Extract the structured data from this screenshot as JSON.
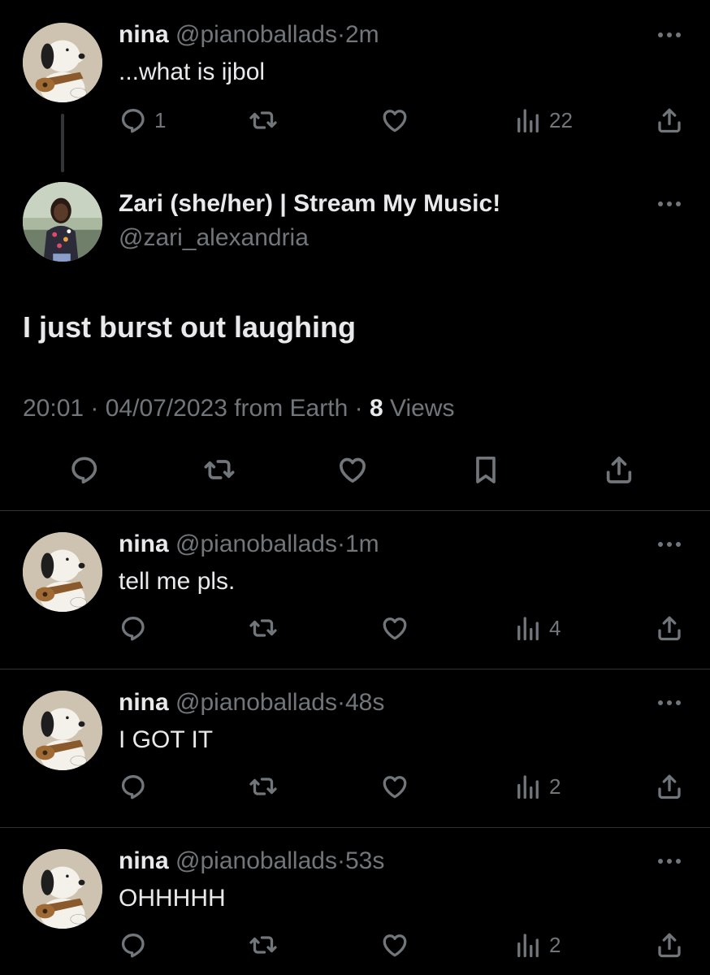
{
  "tweets": [
    {
      "name": "nina",
      "handle": "@pianoballads",
      "time": "2m",
      "text": "...what is ijbol",
      "replies": "1",
      "views": "22"
    },
    {
      "name": "nina",
      "handle": "@pianoballads",
      "time": "1m",
      "text": "tell me pls.",
      "replies": "",
      "views": "4"
    },
    {
      "name": "nina",
      "handle": "@pianoballads",
      "time": "48s",
      "text": "I GOT IT",
      "replies": "",
      "views": "2"
    },
    {
      "name": "nina",
      "handle": "@pianoballads",
      "time": "53s",
      "text": "OHHHHH",
      "replies": "",
      "views": "2"
    }
  ],
  "main_tweet": {
    "name": "Zari (she/her) | Stream My Music!",
    "handle": "@zari_alexandria",
    "text": "I just burst out laughing",
    "timestamp": "20:01 · 04/07/2023 from Earth",
    "views_count": "8",
    "views_label": "Views"
  },
  "separator": "·",
  "icons": [
    "reply-icon",
    "retweet-icon",
    "like-icon",
    "views-icon",
    "share-icon",
    "bookmark-icon",
    "more-icon"
  ],
  "colors": {
    "background": "#000000",
    "text": "#e7e9ea",
    "muted": "#71767b",
    "divider": "#2f3336"
  }
}
